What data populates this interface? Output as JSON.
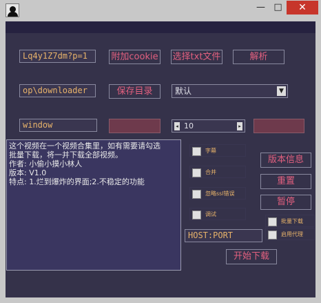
{
  "window": {
    "min_glyph": "—",
    "max_glyph": "□",
    "close_glyph": "✕"
  },
  "row1": {
    "url_input": "Lq4y1Z7dm?p=1",
    "cookie_button": "附加cookie",
    "txt_button": "选择txt文件",
    "parse_button": "解析"
  },
  "row2": {
    "dir_input": "op\\downloader",
    "save_dir_button": "保存目录",
    "quality_select": "默认"
  },
  "row3": {
    "window_input": "window",
    "spin_value": "10"
  },
  "info": {
    "text": "这个视频在一个视频合集里，如有需要请勾选\n批量下载，将一并下载全部视频。\n作者: 小偷小摸小林人\n版本: V1.0\n特点: 1.烂到爆炸的界面;2.不稳定的功能"
  },
  "options": {
    "subtitle": "字幕",
    "merge": "合并",
    "ignore_ssl": "忽略ssl错误",
    "debug": "调试",
    "batch_download": "批量下载",
    "enable_proxy": "启用代理"
  },
  "proxy": {
    "host_port": "HOST:PORT"
  },
  "buttons": {
    "version_info": "版本信息",
    "reset": "重置",
    "pause": "暂停",
    "start_download": "开始下载"
  },
  "colors": {
    "background": "#35324a",
    "accent_pink": "#e2607f",
    "accent_orange": "#e8b36a",
    "disabled_button": "#6e3a4c"
  }
}
